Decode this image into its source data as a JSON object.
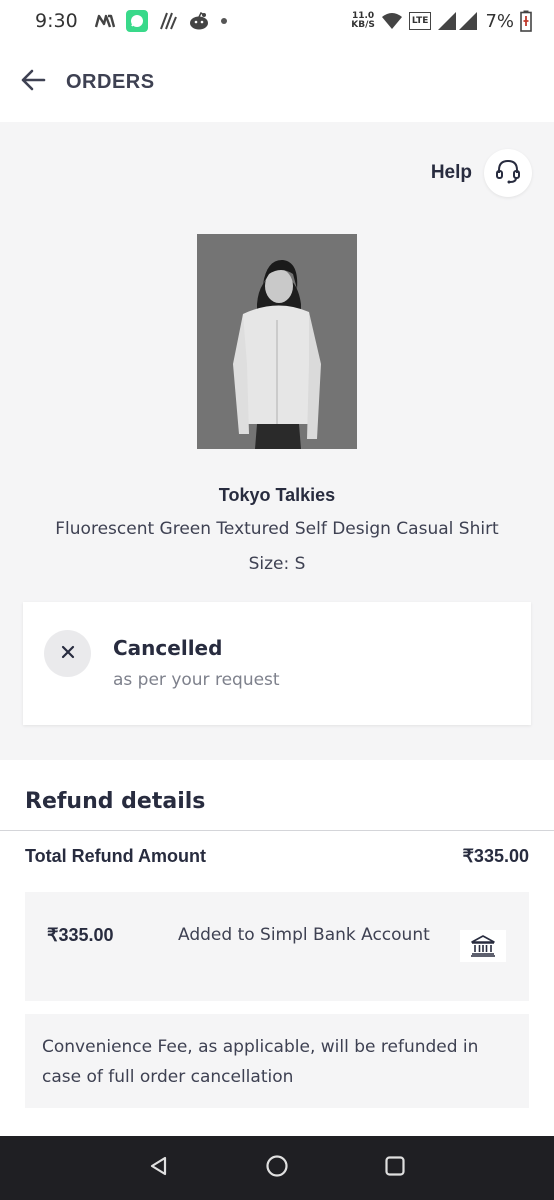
{
  "status_bar": {
    "time": "9:30",
    "network_speed_value": "11.0",
    "network_speed_unit": "KB/S",
    "lte_label": "LTE",
    "battery": "7%",
    "icons": [
      "myntra-icon",
      "chat-app-icon",
      "notes-app-icon",
      "reddit-icon",
      "dot-icon",
      "wifi-icon",
      "signal-icon",
      "battery-icon"
    ]
  },
  "app_bar": {
    "title": "ORDERS",
    "back_icon": "arrow-left-icon"
  },
  "help": {
    "label": "Help",
    "icon": "headset-icon"
  },
  "product": {
    "brand": "Tokyo Talkies",
    "name": "Fluorescent Green Textured Self Design Casual Shirt",
    "size": "Size: S"
  },
  "order_status": {
    "title": "Cancelled",
    "subtitle": "as per your request",
    "icon": "close-icon"
  },
  "refund": {
    "title": "Refund details",
    "total_label": "Total Refund Amount",
    "total_amount": "₹335.00",
    "item": {
      "amount": "₹335.00",
      "description": "Added to Simpl Bank Account",
      "icon": "bank-icon"
    },
    "note": "Convenience Fee, as applicable, will be refunded in case of full order cancellation"
  },
  "nav_bar": {
    "buttons": [
      "back-triangle-icon",
      "home-circle-icon",
      "recents-square-icon"
    ]
  },
  "colors": {
    "text_primary": "#282c3f",
    "text_secondary": "#7e818c",
    "page_bg": "#f5f5f6",
    "card_bg": "#ffffff",
    "nav_bg": "#1f1f23"
  }
}
